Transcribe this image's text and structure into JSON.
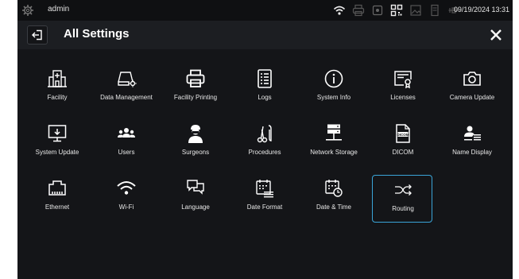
{
  "status": {
    "user": "admin",
    "datetime": "09/19/2024 13:31"
  },
  "header": {
    "title": "All Settings"
  },
  "tiles": [
    {
      "label": "Facility",
      "icon": "facility-icon"
    },
    {
      "label": "Data Management",
      "icon": "data-management-icon"
    },
    {
      "label": "Facility Printing",
      "icon": "printer-icon"
    },
    {
      "label": "Logs",
      "icon": "logs-icon"
    },
    {
      "label": "System Info",
      "icon": "info-icon"
    },
    {
      "label": "Licenses",
      "icon": "license-icon"
    },
    {
      "label": "Camera Update",
      "icon": "camera-icon"
    },
    {
      "label": "System Update",
      "icon": "system-update-icon"
    },
    {
      "label": "Users",
      "icon": "users-icon"
    },
    {
      "label": "Surgeons",
      "icon": "surgeon-icon"
    },
    {
      "label": "Procedures",
      "icon": "scissors-icon"
    },
    {
      "label": "Network Storage",
      "icon": "network-storage-icon"
    },
    {
      "label": "DICOM",
      "icon": "dicom-icon"
    },
    {
      "label": "Name Display",
      "icon": "name-display-icon"
    },
    {
      "label": "Ethernet",
      "icon": "ethernet-icon"
    },
    {
      "label": "Wi-Fi",
      "icon": "wifi-icon"
    },
    {
      "label": "Language",
      "icon": "language-icon"
    },
    {
      "label": "Date Format",
      "icon": "date-format-icon"
    },
    {
      "label": "Date & Time",
      "icon": "date-time-icon"
    },
    {
      "label": "Routing",
      "icon": "routing-icon"
    }
  ],
  "selected_tile": "Routing",
  "colors": {
    "accent": "#3aa5d8",
    "panel": "#141518",
    "header": "#1c1e22"
  },
  "dicom_badge": "DICOM"
}
